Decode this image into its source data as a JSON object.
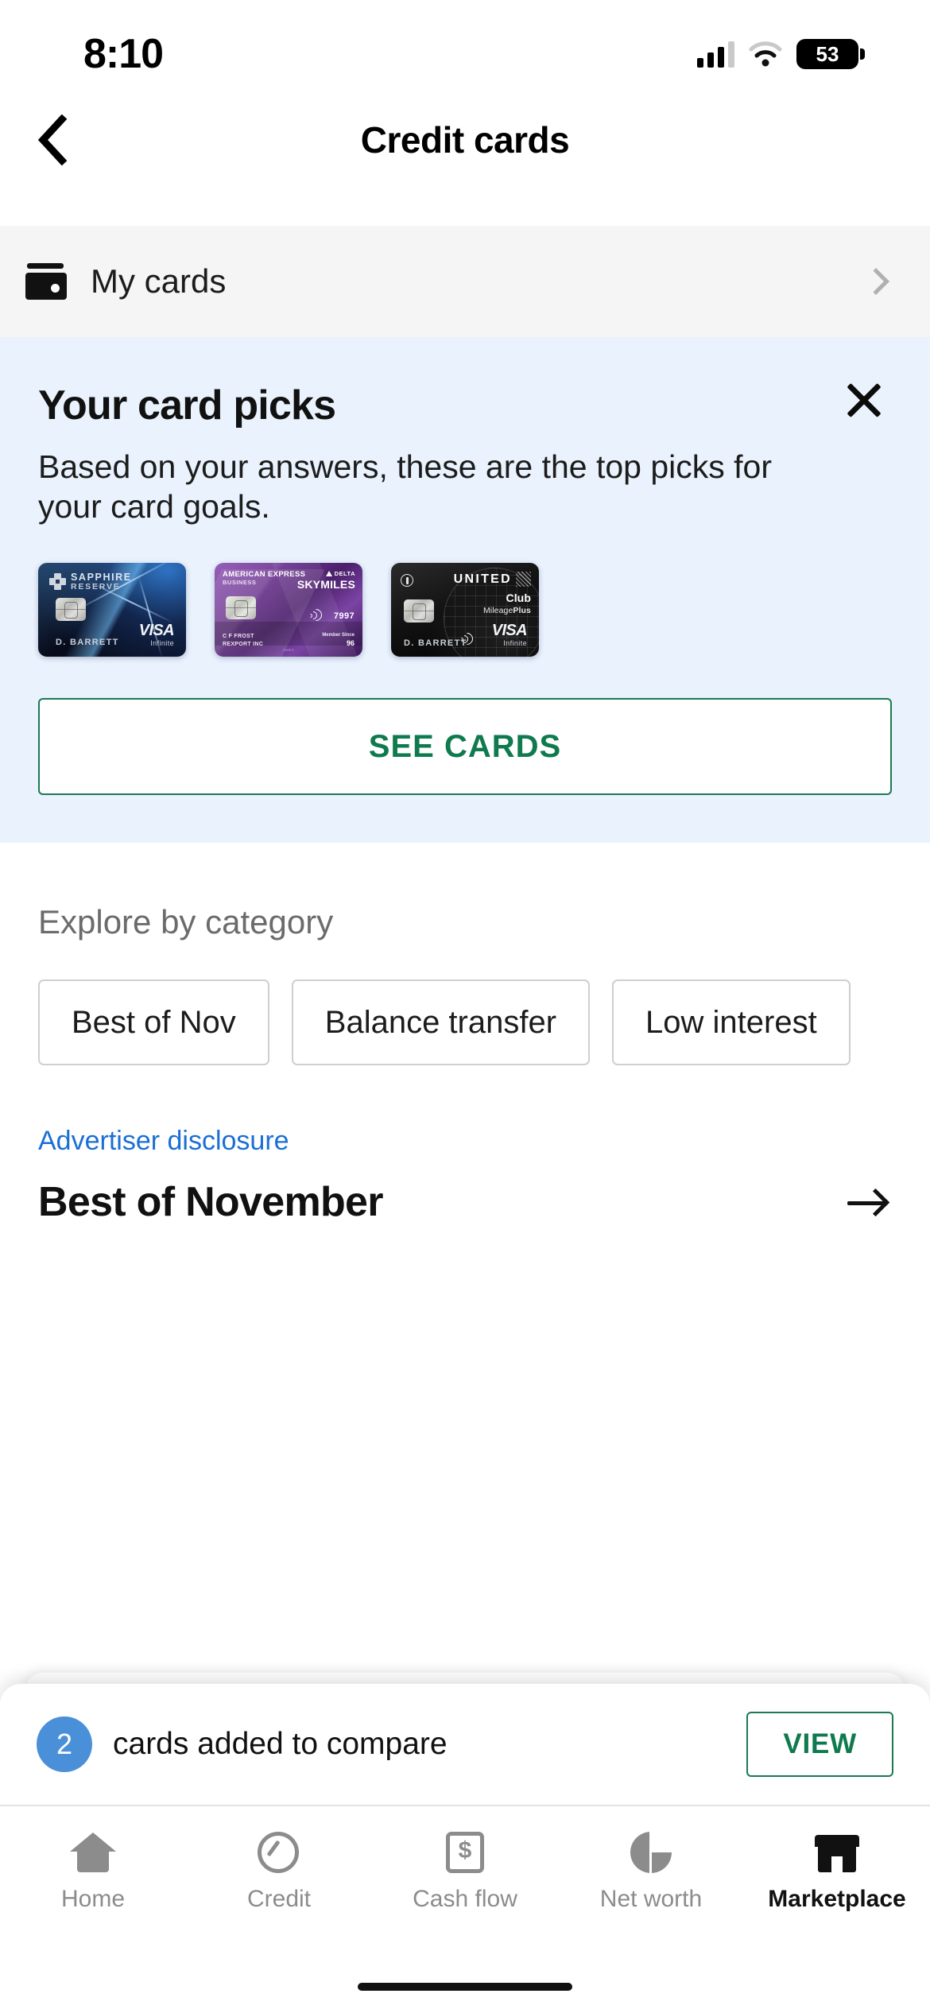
{
  "status_bar": {
    "time": "8:10",
    "battery_level": "53",
    "signal_icon": "cellular-bars-icon",
    "wifi_icon": "wifi-icon",
    "battery_icon": "battery-icon"
  },
  "nav": {
    "back_icon": "chevron-left-icon",
    "title": "Credit cards"
  },
  "my_cards_row": {
    "label": "My cards",
    "wallet_icon": "wallet-icon",
    "chevron_icon": "chevron-right-icon"
  },
  "promo": {
    "title": "Your card picks",
    "subtitle": "Based on your answers, these are the top picks for your card goals.",
    "close_icon": "close-x-icon",
    "cta_label": "SEE CARDS",
    "background_color": "#e9f2fd",
    "cta_color": "#0f7a4e",
    "cards": [
      {
        "issuer": "SAPPHIRE",
        "tier": "RESERVE",
        "holder": "D. BARRETT",
        "network": "VISA",
        "network_tier": "Infinite",
        "logo_icon": "chase-octagon-icon",
        "chip_icon": "emv-chip-icon"
      },
      {
        "issuer": "AMERICAN EXPRESS",
        "tier": "BUSINESS",
        "partner": "DELTA",
        "program": "SKYMILES",
        "contactless_icon": "contactless-pay-icon",
        "last_four": "7997",
        "holder": "C F FROST",
        "holder_line2": "REXPORT INC",
        "member_since_label": "Member Since",
        "member_since": "96",
        "chip_icon": "emv-chip-icon"
      },
      {
        "issuer": "UNITED",
        "tier": "Club",
        "program": "MileagePlus",
        "holder": "D. BARRETT",
        "network": "VISA",
        "network_tier": "Infinite",
        "contactless_icon": "contactless-pay-icon",
        "logo_icon": "united-globe-icon",
        "chip_icon": "emv-chip-icon"
      }
    ]
  },
  "explore": {
    "heading": "Explore by category",
    "categories": [
      {
        "label": "Best of Nov"
      },
      {
        "label": "Balance transfer"
      },
      {
        "label": "Low interest"
      }
    ]
  },
  "best_of": {
    "disclosure_label": "Advertiser disclosure",
    "title": "Best of November",
    "arrow_icon": "arrow-right-icon",
    "disclosure_color": "#1a6fd4"
  },
  "compare_bar": {
    "count": "2",
    "text": "cards added to compare",
    "button_label": "VIEW",
    "badge_color": "#4a90d9",
    "button_color": "#0f7a4e"
  },
  "tab_bar": {
    "items": [
      {
        "label": "Home",
        "icon": "home-icon",
        "active": false
      },
      {
        "label": "Credit",
        "icon": "gauge-icon",
        "active": false
      },
      {
        "label": "Cash flow",
        "icon": "dollar-square-icon",
        "active": false
      },
      {
        "label": "Net worth",
        "icon": "pie-chart-icon",
        "active": false
      },
      {
        "label": "Marketplace",
        "icon": "storefront-icon",
        "active": true
      }
    ]
  }
}
